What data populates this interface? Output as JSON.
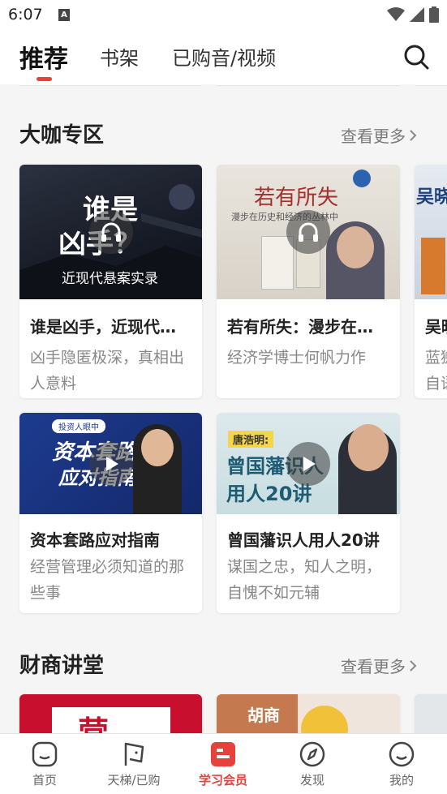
{
  "status": {
    "time": "6:07",
    "notif": "A"
  },
  "tabs": [
    {
      "label": "推荐"
    },
    {
      "label": "书架"
    },
    {
      "label": "已购音/视频"
    }
  ],
  "section1": {
    "title": "大咖专区",
    "more": "查看更多",
    "cards": [
      {
        "title": "谁是凶手，近现代…",
        "desc": "凶手隐匿极深，真相出人意料",
        "cover_text1": "谁是",
        "cover_text2": "凶手？",
        "cover_sub": "近现代悬案实录"
      },
      {
        "title": "若有所失：漫步在…",
        "desc": "经济学博士何帆力作",
        "cover_text1": "若有所失",
        "cover_sub": "漫步在历史和经济的丛林中"
      },
      {
        "title": "吴晓",
        "desc": "蓝狮 自语",
        "cover_text1": "吴晓"
      },
      {
        "title": "资本套路应对指南",
        "desc": "经营管理必须知道的那些事",
        "cover_text1": "资本套路",
        "cover_text2": "应对指南",
        "cover_sub": "投资人眼中"
      },
      {
        "title": "曾国藩识人用人20讲",
        "desc": "谋国之忠，知人之明，自愧不如元辅",
        "cover_tag": "唐浩明:",
        "cover_text1": "曾国藩识人",
        "cover_text2": "用人20讲"
      }
    ]
  },
  "section2": {
    "title": "财商讲堂",
    "more": "查看更多",
    "covers": [
      {
        "text": "营"
      },
      {
        "text": "胡商"
      }
    ]
  },
  "bottom_nav": [
    {
      "label": "首页",
      "icon": "home-icon"
    },
    {
      "label": "天梯/已购",
      "icon": "flag-icon"
    },
    {
      "label": "学习会员",
      "icon": "member-book-icon"
    },
    {
      "label": "发现",
      "icon": "compass-icon"
    },
    {
      "label": "我的",
      "icon": "profile-icon"
    }
  ],
  "colors": {
    "accent": "#e8403b"
  }
}
